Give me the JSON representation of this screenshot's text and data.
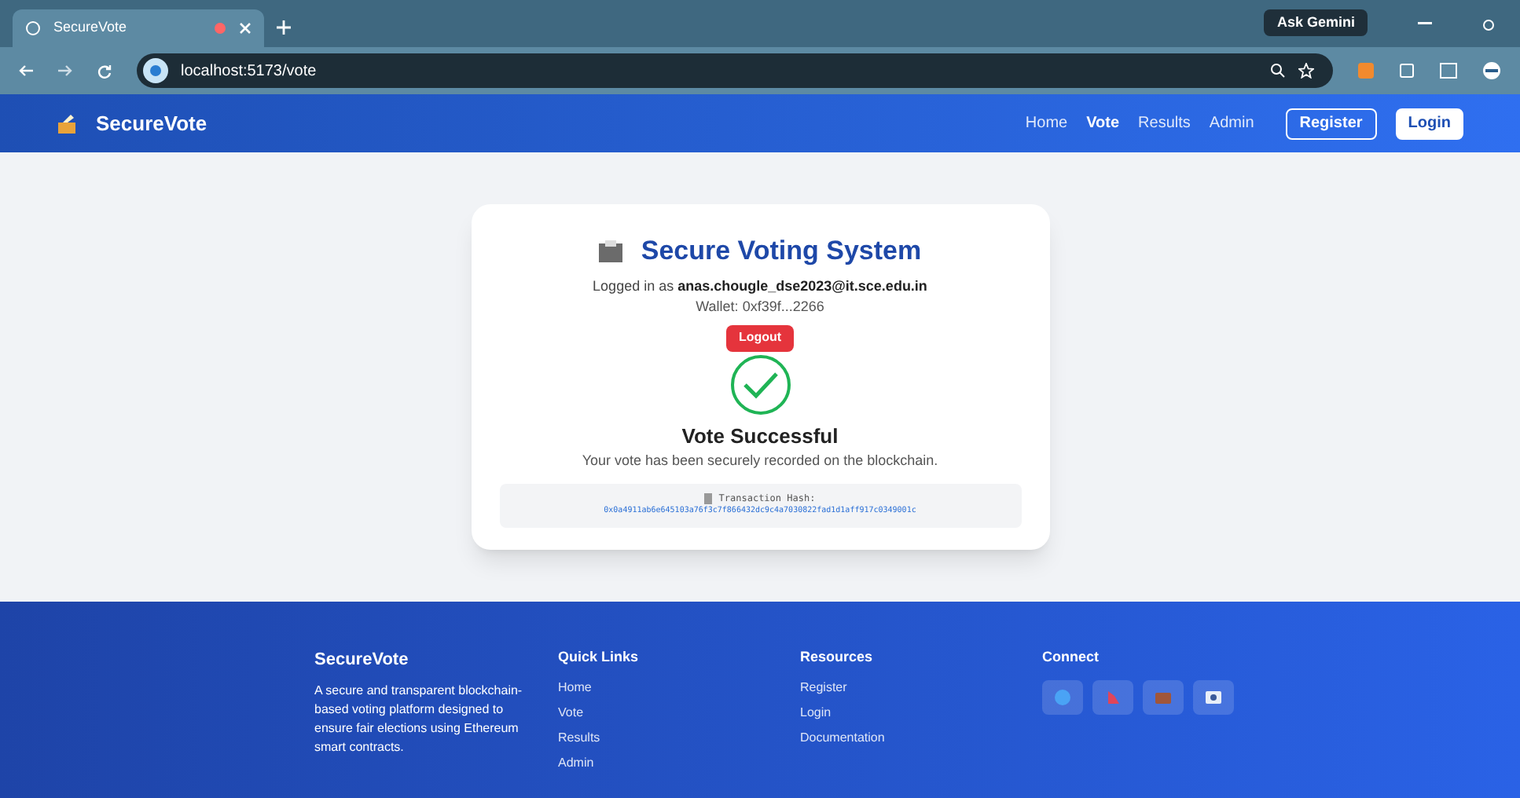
{
  "browser": {
    "tab_title": "SecureVote",
    "address": "localhost:5173/vote",
    "gemini_button": "Ask Gemini"
  },
  "navbar": {
    "brand": "SecureVote",
    "links": [
      {
        "label": "Home",
        "selected": false
      },
      {
        "label": "Vote",
        "selected": true
      },
      {
        "label": "Results",
        "selected": false
      },
      {
        "label": "Admin",
        "selected": false
      }
    ],
    "register_button": "Register",
    "login_button": "Login"
  },
  "card": {
    "title": "Secure Voting System",
    "logged_in_label": "Logged in as",
    "email": "anas.chougle_dse2023@it.sce.edu.in",
    "wallet": "Wallet: 0xf39f...2266",
    "logout_button": "Logout",
    "status_title": "Vote Successful",
    "status_message": "Your vote has been securely recorded on the blockchain.",
    "hash_label": "Transaction Hash:",
    "hash": "0x0a4911ab6e645103a76f3c7f866432dc9c4a7030822fad1d1aff917c0349001c"
  },
  "footer": {
    "brand": "SecureVote",
    "description": "A secure and transparent blockchain-based voting platform designed to ensure fair elections using Ethereum smart contracts.",
    "columns": [
      {
        "title": "Quick Links",
        "links": [
          "Home",
          "Vote",
          "Results",
          "Admin"
        ]
      },
      {
        "title": "Resources",
        "links": [
          "Register",
          "Login",
          "Documentation"
        ]
      }
    ],
    "connect_title": "Connect"
  }
}
